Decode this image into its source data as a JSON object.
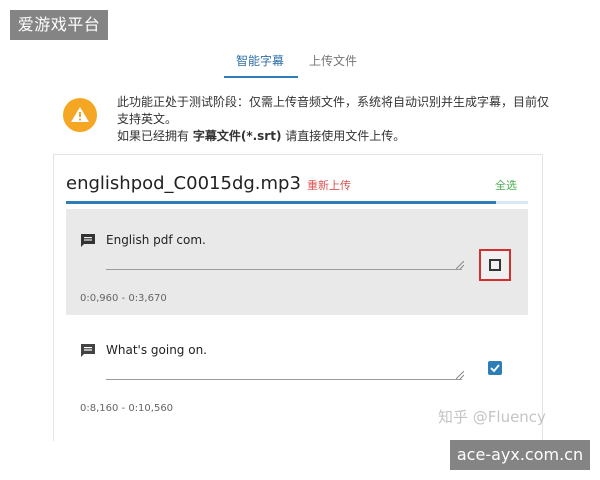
{
  "overlay": {
    "site_badge": "爱游戏平台",
    "url_badge": "ace-ayx.com.cn",
    "watermark": "知乎 @Fluency"
  },
  "tabs": [
    {
      "label": "智能字幕",
      "active": true
    },
    {
      "label": "上传文件",
      "active": false
    }
  ],
  "notice": {
    "icon": "warning-icon",
    "line1": "此功能正处于测试阶段：仅需上传音频文件，系统将自动识别并生成字幕，目前仅支持英文。",
    "line2_prefix": "如果已经拥有 ",
    "line2_bold": "字幕文件(*.srt)",
    "line2_suffix": " 请直接使用文件上传。",
    "icon_color": "#f5a623"
  },
  "file": {
    "name": "englishpod_C0015dg.mp3",
    "reupload_label": "重新上传",
    "select_all_label": "全选",
    "progress": 0.93
  },
  "subtitles": [
    {
      "text": "English pdf com.",
      "time": "0:0,960 - 0:3,670",
      "checked": false,
      "highlighted": true
    },
    {
      "text": "What's going on.",
      "time": "0:8,160 - 0:10,560",
      "checked": true,
      "highlighted": false
    }
  ],
  "colors": {
    "accent": "#2f7db6",
    "danger": "#d32f2f",
    "success": "#4caf50"
  }
}
